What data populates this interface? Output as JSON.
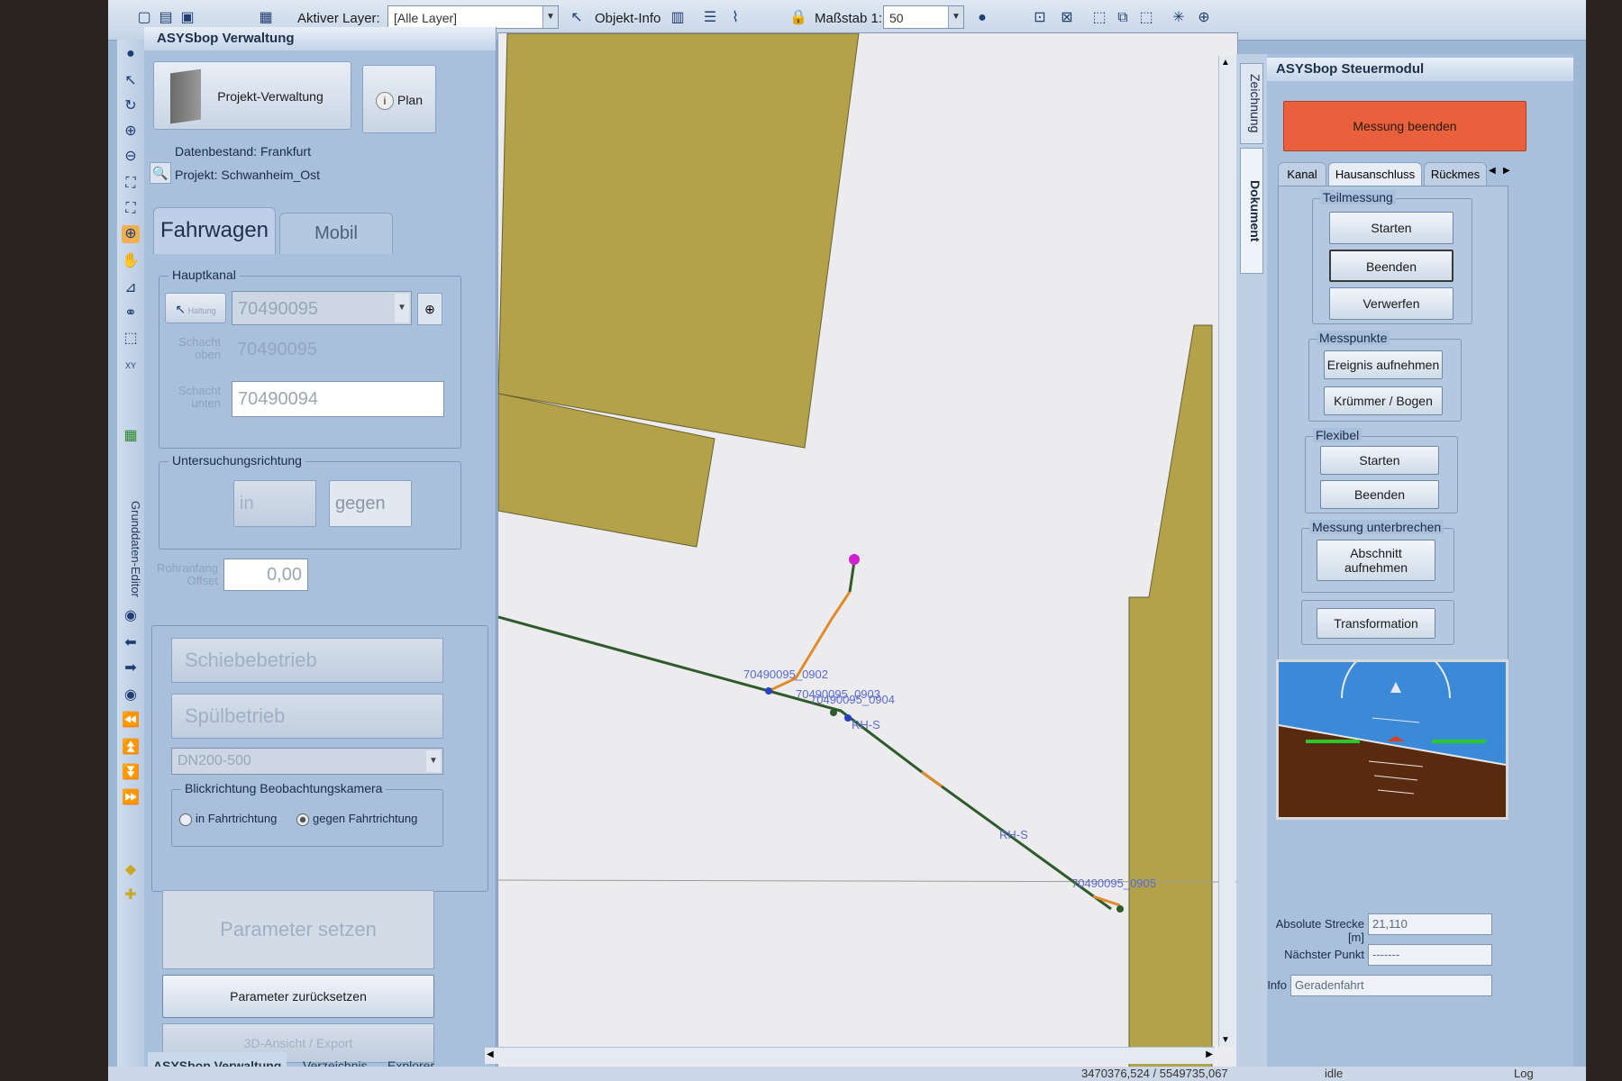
{
  "toolbar": {
    "active_layer_label": "Aktiver Layer:",
    "active_layer_value": "[Alle Layer]",
    "objekt_info_label": "Objekt-Info",
    "massstab_label": "Maßstab 1:",
    "massstab_value": "50"
  },
  "left_toolbar": {
    "vertical_label": "Grunddaten-Editor",
    "xy_label": "XY"
  },
  "left_panel": {
    "title": "ASYSbop Verwaltung",
    "projekt_button": "Projekt-Verwaltung",
    "plan_button": "Plan",
    "datenbestand": "Datenbestand: Frankfurt",
    "projekt": "Projekt: Schwanheim_Ost",
    "tabs": [
      "Fahrwagen",
      "Mobil"
    ],
    "hauptkanal": {
      "title": "Hauptkanal",
      "haltung_button": "Haltung",
      "haltung_value": "70490095",
      "schacht_oben_label": "Schacht oben",
      "schacht_oben_value": "70490095",
      "schacht_unten_label": "Schacht unten",
      "schacht_unten_value": "70490094"
    },
    "untersuchung": {
      "title": "Untersuchungsrichtung",
      "in_label": "in",
      "gegen_label": "gegen"
    },
    "rohranfang_label": "Rohranfang Offset",
    "rohranfang_value": "0,00",
    "schiebebetrieb": "Schiebebetrieb",
    "spuelbetrieb": "Spülbetrieb",
    "dn_value": "DN200-500",
    "kamera": {
      "title": "Blickrichtung Beobachtungskamera",
      "option1": "in Fahrtrichtung",
      "option2": "gegen Fahrtrichtung"
    },
    "parameter_setzen": "Parameter setzen",
    "parameter_zuruecksetzen": "Parameter zurücksetzen",
    "ansicht_export": "3D-Ansicht / Export",
    "bottom_tabs": [
      "ASYSbop Verwaltung",
      "Verzeichnis",
      "Explorer"
    ]
  },
  "map": {
    "labels": [
      "70490095_0902",
      "70490095_0903",
      "70490095_0904",
      "RH-S",
      "RH-S",
      "70490095_0905"
    ]
  },
  "side_tabs": [
    "Zeichnung",
    "Dokument"
  ],
  "right_panel": {
    "title": "ASYSbop Steuermodul",
    "messung_beenden": "Messung beenden",
    "tabs": [
      "Kanal",
      "Hausanschluss",
      "Rückmes"
    ],
    "teilmessung": {
      "title": "Teilmessung",
      "buttons": [
        "Starten",
        "Beenden",
        "Verwerfen"
      ]
    },
    "messpunkte": {
      "title": "Messpunkte",
      "buttons": [
        "Ereignis aufnehmen",
        "Krümmer / Bogen"
      ]
    },
    "flexibel": {
      "title": "Flexibel",
      "buttons": [
        "Starten",
        "Beenden"
      ]
    },
    "unterbrechen": {
      "title": "Messung unterbrechen",
      "button": "Abschnitt aufnehmen"
    },
    "transformation": "Transformation",
    "absolute_strecke_label": "Absolute Strecke [m]",
    "absolute_strecke_value": "21,110",
    "naechster_punkt_label": "Nächster Punkt",
    "naechster_punkt_value": "-------",
    "info_label": "Info",
    "info_value": "Geradenfahrt"
  },
  "status": {
    "coords": "3470376,524 / 5549735,067",
    "state": "idle",
    "log": "Log"
  },
  "colors": {
    "building": "#b3a24a",
    "pipe": "#2f5a2a",
    "pipe_orange": "#e08a2a",
    "node_blue": "#2a3fc8",
    "endpoint_magenta": "#d020d0",
    "stop_button": "#e8603c"
  }
}
